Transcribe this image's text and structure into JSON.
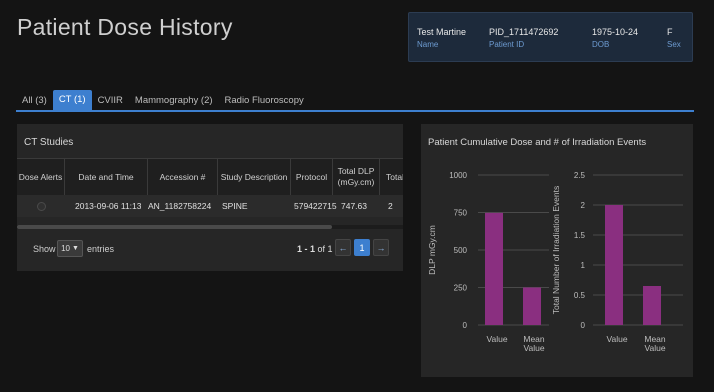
{
  "page": {
    "title": "Patient Dose History"
  },
  "patient": {
    "name": {
      "value": "Test Martine",
      "label": "Name"
    },
    "pid": {
      "value": "PID_1711472692",
      "label": "Patient ID"
    },
    "dob": {
      "value": "1975-10-24",
      "label": "DOB"
    },
    "sex": {
      "value": "F",
      "label": "Sex"
    }
  },
  "tabs": [
    {
      "label": "All (3)",
      "active": false
    },
    {
      "label": "CT (1)",
      "active": true
    },
    {
      "label": "CVIIR",
      "active": false
    },
    {
      "label": "Mammography (2)",
      "active": false
    },
    {
      "label": "Radio Fluoroscopy",
      "active": false
    }
  ],
  "studies": {
    "title": "CT Studies",
    "headers": [
      "Dose Alerts",
      "Date and Time",
      "Accession #",
      "Study Description",
      "Protocol",
      "Total DLP (mGy.cm)",
      "Total Numl"
    ],
    "rows": [
      [
        "",
        "2013-09-06 11:13",
        "AN_1182758224",
        "SPINE",
        "579422715",
        "747.63",
        "2"
      ]
    ],
    "show_label": "Show",
    "page_length": "10",
    "entries_label": "entries",
    "page_info_range": "1 - 1",
    "page_info_total": " of 1",
    "prev_icon": "←",
    "current_page": "1",
    "next_icon": "→"
  },
  "chart": {
    "title": "Patient Cumulative Dose and # of Irradiation Events",
    "bar_color": "#8a2f80"
  },
  "chart_data": [
    {
      "type": "bar",
      "categories": [
        "Value",
        "Mean Value"
      ],
      "values": [
        747.63,
        250
      ],
      "ylabel": "DLP mGy.cm",
      "ylim": [
        0,
        1000
      ],
      "yticks": [
        0,
        250,
        500,
        750,
        1000
      ],
      "grid": true
    },
    {
      "type": "bar",
      "categories": [
        "Value",
        "Mean Value"
      ],
      "values": [
        2,
        0.65
      ],
      "ylabel": "Total Number of Irradiation Events",
      "ylim": [
        0,
        2.5
      ],
      "yticks": [
        0,
        0.5,
        1,
        1.5,
        2,
        2.5
      ],
      "grid": true
    }
  ]
}
